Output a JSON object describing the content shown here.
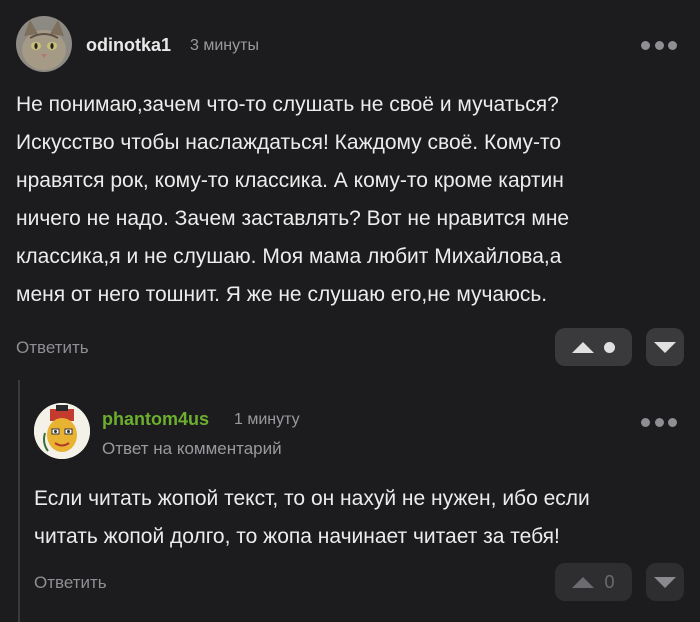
{
  "comments": [
    {
      "username": "odinotka1",
      "time": "3 минуты",
      "username_color": "#e8e8e8",
      "text": "Не понимаю,зачем что-то слушать не своё и мучаться?\nИскусство чтобы наслаждаться! Каждому своё. Кому-то\nнравятся рок, кому-то классика. А кому-то кроме картин\nничего не надо. Зачем заставлять? Вот не нравится мне\nклассика,я и не слушаю. Моя мама любит Михайлова,а\nменя от него тошнит. Я же не слушаю его,не мучаюсь.",
      "reply_label": "Ответить",
      "score": "",
      "avatar_icon": "cat-avatar-icon"
    },
    {
      "username": "phantom4us",
      "time": "1 минуту",
      "username_color": "#6cae2e",
      "reply_to": "Ответ на комментарий",
      "text": "Если читать жопой текст, то он нахуй не нужен, ибо если\nчитать жопой долго, то жопа начинает читает за тебя!",
      "reply_label": "Ответить",
      "score": "0",
      "avatar_icon": "cartoon-face-avatar-icon"
    }
  ],
  "colors": {
    "background": "#1c1c1e",
    "button": "#3a3a3c",
    "muted_text": "#9a9a9e",
    "accent_username": "#6cae2e"
  }
}
